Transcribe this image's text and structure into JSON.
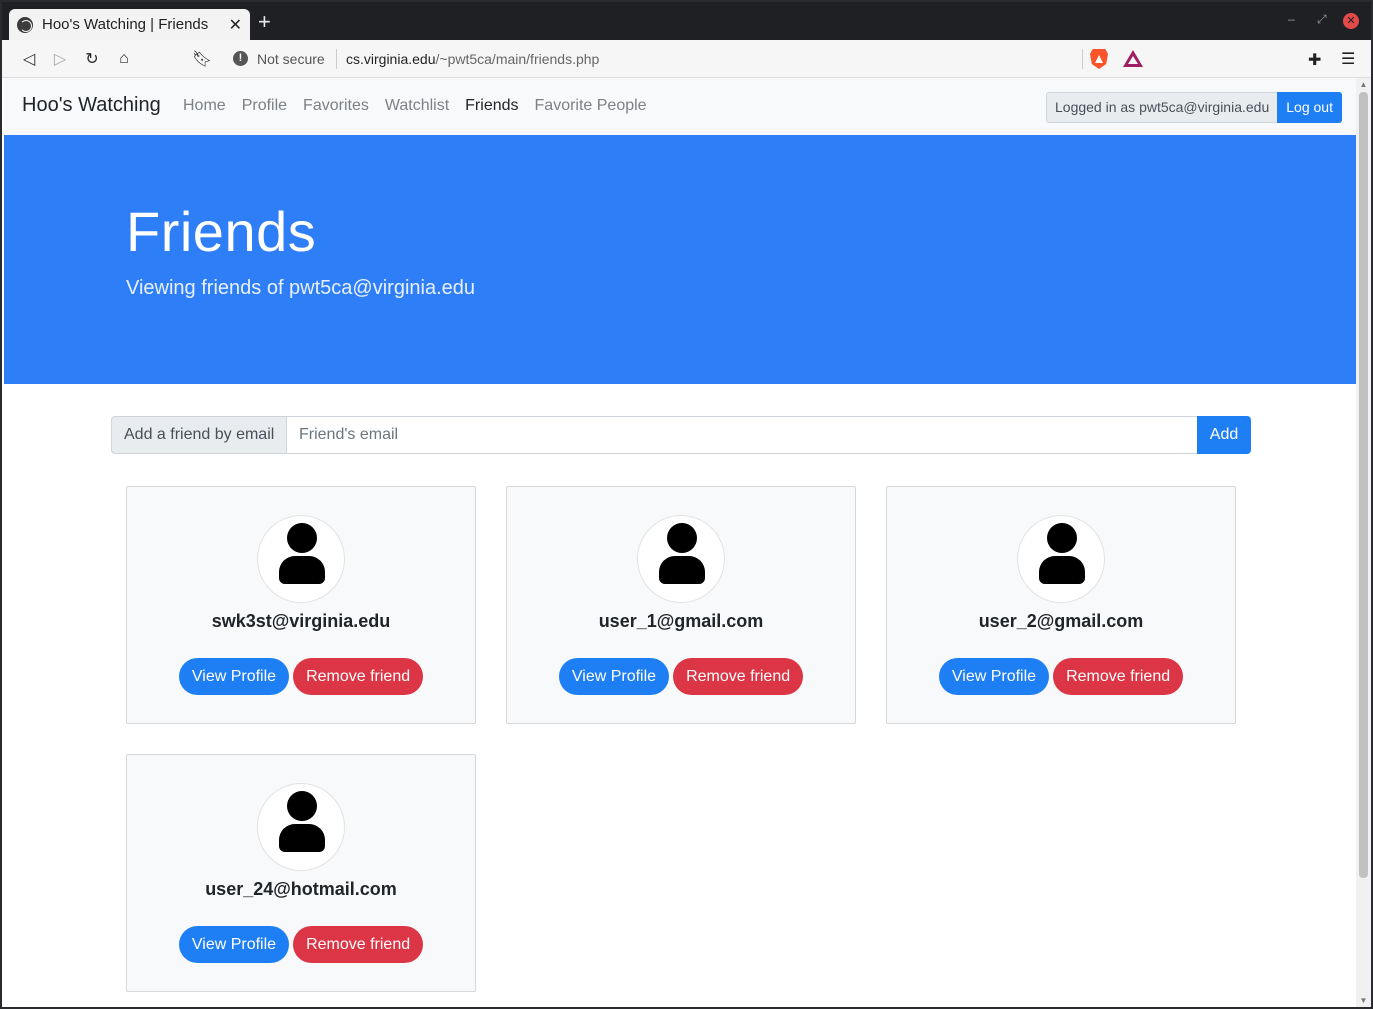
{
  "browser": {
    "tab_title": "Hoo's Watching | Friends",
    "security_label": "Not secure",
    "url_host": "cs.virginia.edu",
    "url_path": "/~pwt5ca/main/friends.php"
  },
  "navbar": {
    "brand": "Hoo's Watching",
    "links": [
      {
        "label": "Home",
        "active": false
      },
      {
        "label": "Profile",
        "active": false
      },
      {
        "label": "Favorites",
        "active": false
      },
      {
        "label": "Watchlist",
        "active": false
      },
      {
        "label": "Friends",
        "active": true
      },
      {
        "label": "Favorite People",
        "active": false
      }
    ],
    "login_status": "Logged in as pwt5ca@virginia.edu",
    "logout_label": "Log out"
  },
  "hero": {
    "title": "Friends",
    "subtitle": "Viewing friends of pwt5ca@virginia.edu"
  },
  "add_friend": {
    "label": "Add a friend by email",
    "placeholder": "Friend's email",
    "value": "",
    "button": "Add"
  },
  "friends": [
    {
      "email": "swk3st@virginia.edu",
      "view_label": "View Profile",
      "remove_label": "Remove friend"
    },
    {
      "email": "user_1@gmail.com",
      "view_label": "View Profile",
      "remove_label": "Remove friend"
    },
    {
      "email": "user_2@gmail.com",
      "view_label": "View Profile",
      "remove_label": "Remove friend"
    },
    {
      "email": "user_24@hotmail.com",
      "view_label": "View Profile",
      "remove_label": "Remove friend"
    }
  ],
  "colors": {
    "primary": "#1e7ff5",
    "hero": "#2e7ef7",
    "danger": "#dc3545"
  }
}
